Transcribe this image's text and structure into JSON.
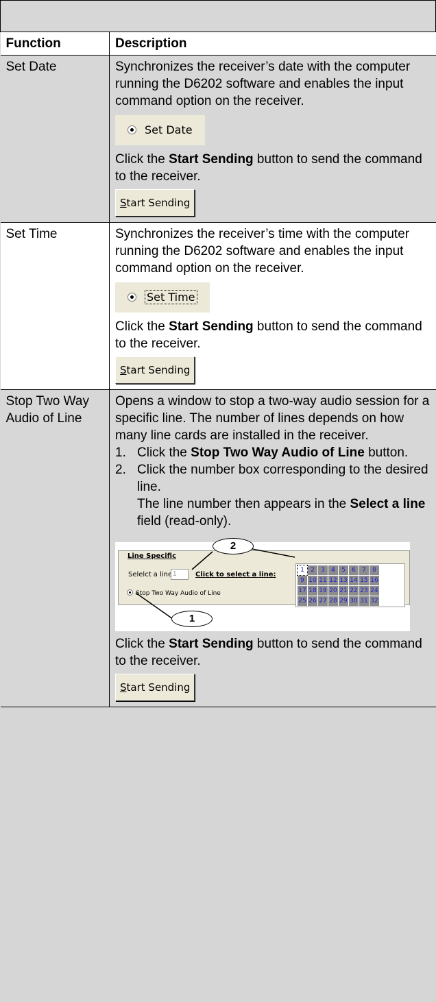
{
  "headers": {
    "function": "Function",
    "description": "Description"
  },
  "rows": [
    {
      "function": "Set Date",
      "description": "Synchronizes the receiver’s date with the computer running the D6202 software and enables the input command option on the receiver.",
      "radio_label": "Set Date",
      "click_pre": "Click the ",
      "click_bold": "Start Sending",
      "click_post": " button to send the command to the receiver.",
      "button_first": "S",
      "button_rest": "tart Sending"
    },
    {
      "function": "Set Time",
      "description": "Synchronizes the receiver’s time with the computer running the D6202 software and enables the input command option on the receiver.",
      "radio_label": "Set Time",
      "click_pre": "Click the ",
      "click_bold": "Start Sending",
      "click_post": " button to send the command to the receiver.",
      "button_first": "S",
      "button_rest": "tart Sending"
    },
    {
      "function": "Stop Two Way Audio of Line",
      "description": "Opens a window to stop a two-way audio session for a specific line. The number of lines depends on how many line cards are installed in the receiver.",
      "steps": [
        {
          "num": "1.",
          "pre": "Click the ",
          "bold": "Stop Two Way Audio of Line",
          "post": " button."
        },
        {
          "num": "2.",
          "pre": "Click the number box corresponding to the desired line.",
          "bold": "",
          "post": ""
        }
      ],
      "step2_note_pre": "The line number then appears in the ",
      "step2_note_bold": "Select a line",
      "step2_note_post": " field (read-only).",
      "figure": {
        "legend": "Line Specific",
        "select_label": "Selelct a line:",
        "select_value": "1",
        "link_text": "Click to select a line:",
        "radio_label": "Stop Two Way Audio of Line",
        "grid_numbers": [
          "1",
          "2",
          "3",
          "4",
          "5",
          "6",
          "7",
          "8",
          "9",
          "10",
          "11",
          "12",
          "13",
          "14",
          "15",
          "16",
          "17",
          "18",
          "19",
          "20",
          "21",
          "22",
          "23",
          "24",
          "25",
          "26",
          "27",
          "28",
          "29",
          "30",
          "31",
          "32"
        ],
        "callout_1": "1",
        "callout_2": "2"
      },
      "click_pre": "Click the ",
      "click_bold": "Start Sending",
      "click_post": " button to send the command to the receiver.",
      "button_first": "S",
      "button_rest": "tart Sending"
    }
  ]
}
